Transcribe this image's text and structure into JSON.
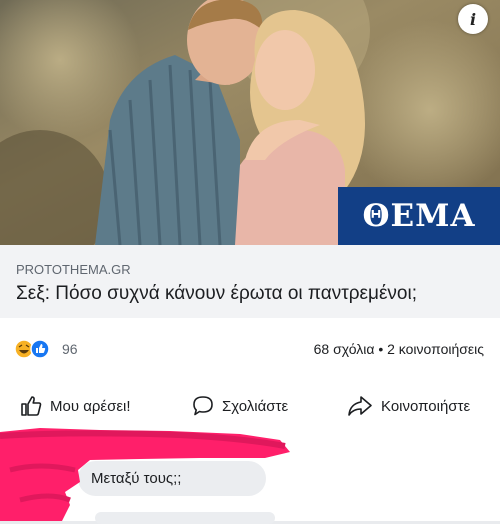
{
  "post": {
    "domain": "PROTOTHEMA.GR",
    "headline": "Σεξ: Πόσο συχνά κάνουν έρωτα οι παντρεμένοι;",
    "image_badge": "ΘΕΜΑ",
    "info_icon": "i",
    "reactions": {
      "icons": [
        "haha-icon",
        "like-icon"
      ],
      "count": "96"
    },
    "stats_right": "68 σχόλια • 2 κοινοποιήσεις"
  },
  "actions": {
    "like_label": "Μου αρέσει!",
    "comment_label": "Σχολιάστε",
    "share_label": "Κοινοποιήστε"
  },
  "comment": {
    "text": "Μεταξύ τους;;"
  },
  "colors": {
    "badge_blue": "#123f86",
    "link_box_bg": "#f2f3f5",
    "bubble_bg": "#ebedf0",
    "scribble_pink": "#ff1f6a"
  }
}
